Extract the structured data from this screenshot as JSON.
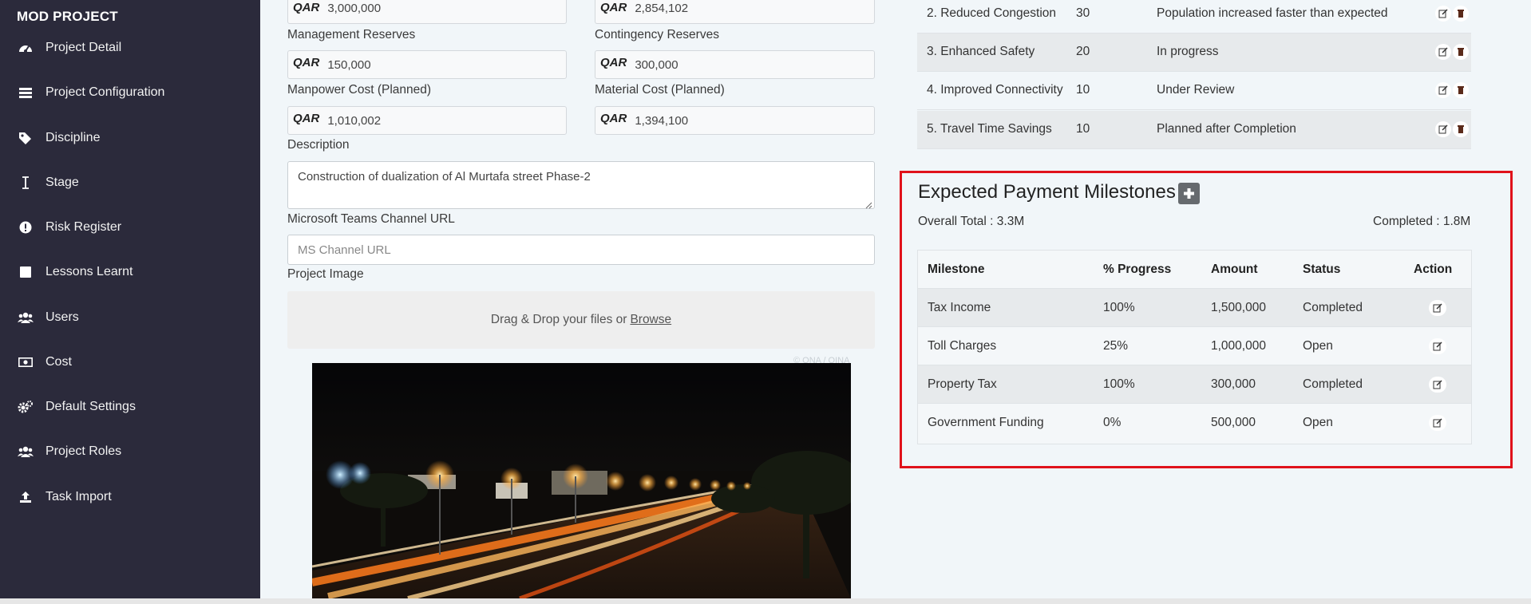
{
  "sidebar": {
    "brand": "MOD PROJECT",
    "items": [
      {
        "label": "Project Detail",
        "icon": "dashboard-icon"
      },
      {
        "label": "Project Configuration",
        "icon": "list-icon"
      },
      {
        "label": "Discipline",
        "icon": "tags-icon"
      },
      {
        "label": "Stage",
        "icon": "text-cursor-icon"
      },
      {
        "label": "Risk Register",
        "icon": "exclamation-circle-icon"
      },
      {
        "label": "Lessons Learnt",
        "icon": "square-icon"
      },
      {
        "label": "Users",
        "icon": "users-icon"
      },
      {
        "label": "Cost",
        "icon": "money-icon"
      },
      {
        "label": "Default Settings",
        "icon": "cogs-icon"
      },
      {
        "label": "Project Roles",
        "icon": "users-icon"
      },
      {
        "label": "Task Import",
        "icon": "upload-icon"
      }
    ]
  },
  "form": {
    "currency": "QAR",
    "budget_value": "3,000,000",
    "actual_value": "2,854,102",
    "management_reserves_label": "Management Reserves",
    "management_reserves_value": "150,000",
    "contingency_reserves_label": "Contingency Reserves",
    "contingency_reserves_value": "300,000",
    "manpower_cost_label": "Manpower Cost (Planned)",
    "manpower_cost_value": "1,010,002",
    "material_cost_label": "Material Cost (Planned)",
    "material_cost_value": "1,394,100",
    "description_label": "Description",
    "description_value": "Construction of dualization of Al Murtafa street Phase-2",
    "teams_url_label": "Microsoft Teams Channel URL",
    "teams_url_placeholder": "MS Channel URL",
    "project_image_label": "Project Image",
    "dropzone_text": "Drag & Drop your files or",
    "dropzone_browse": "Browse",
    "image_credit": "© QNA / QINA"
  },
  "benefits": {
    "rows": [
      {
        "name": "2. Reduced Congestion",
        "value": "30",
        "status": "Population increased faster than expected"
      },
      {
        "name": "3. Enhanced Safety",
        "value": "20",
        "status": "In progress"
      },
      {
        "name": "4. Improved Connectivity",
        "value": "10",
        "status": "Under Review"
      },
      {
        "name": "5. Travel Time Savings",
        "value": "10",
        "status": "Planned after Completion"
      }
    ]
  },
  "milestones": {
    "title": "Expected Payment Milestones",
    "overall_total": "Overall Total : 3.3M",
    "completed": "Completed : 1.8M",
    "headers": {
      "milestone": "Milestone",
      "progress": "% Progress",
      "amount": "Amount",
      "status": "Status",
      "action": "Action"
    },
    "rows": [
      {
        "milestone": "Tax Income",
        "progress": "100%",
        "amount": "1,500,000",
        "status": "Completed"
      },
      {
        "milestone": "Toll Charges",
        "progress": "25%",
        "amount": "1,000,000",
        "status": "Open"
      },
      {
        "milestone": "Property Tax",
        "progress": "100%",
        "amount": "300,000",
        "status": "Completed"
      },
      {
        "milestone": "Government Funding",
        "progress": "0%",
        "amount": "500,000",
        "status": "Open"
      }
    ],
    "highlight_color": "#e0121b"
  }
}
